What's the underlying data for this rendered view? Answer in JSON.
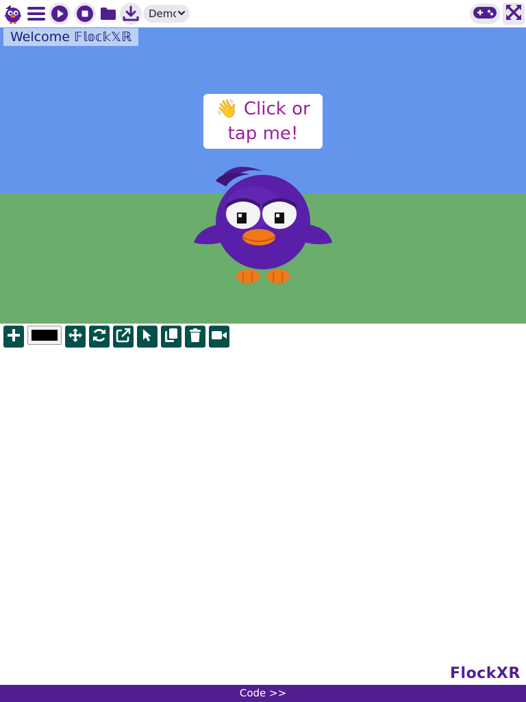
{
  "toolbar": {
    "logo": "bird-logo",
    "demo_select": {
      "selected": "Demo"
    },
    "icons": [
      "menu-icon",
      "play-icon",
      "stop-icon",
      "folder-icon",
      "download-icon",
      "gamepad-icon",
      "fullscreen-icon"
    ]
  },
  "canvas": {
    "welcome_text": "Welcome 𝔽𝕝𝕠𝕔𝕜𝕏ℝ",
    "speech_text": "👋 Click or tap me!",
    "colors": {
      "sky": "#6495ed",
      "ground": "#6aad6c",
      "bird": "#5a1fa8",
      "beak": "#f07a1a"
    }
  },
  "tools": {
    "icons": [
      "plus-icon",
      "move-icon",
      "rotate-icon",
      "external-link-icon",
      "pointer-icon",
      "copy-icon",
      "trash-icon",
      "video-camera-icon"
    ],
    "color_value": "#000000"
  },
  "brand": {
    "text": "FlockXR"
  },
  "footer": {
    "code_label": "Code >>"
  },
  "accent": "#511f90",
  "tool_color": "#04504a"
}
